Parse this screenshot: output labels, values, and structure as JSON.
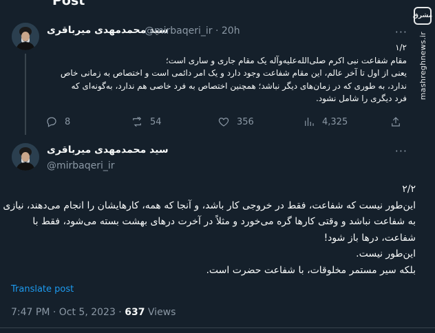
{
  "header": {
    "title": "Post"
  },
  "watermark": {
    "logo_text": "مشرق",
    "url": "mashreghnews.ir"
  },
  "tweet1": {
    "author_name": "سید محمدمهدی میرباقری",
    "meta": "@mirbaqeri_ir · 20h",
    "more": "···",
    "lines": [
      "۱/۲",
      "مقام شفاعت نبی اکرم صلی‌الله‌علیه‌وآله یک مقام جاری و ساری است؛",
      "یعنی از اول تا آخر عالم، این مقام شفاعت وجود دارد و یک امر دائمی است و اختصاص به زمانی خاص",
      "ندارد، به طوری که در زمان‌های دیگر نباشد؛ همچنین اختصاص به فرد خاصی هم ندارد، به‌گونه‌ای که",
      "فرد دیگری را شامل نشود."
    ],
    "stats": {
      "replies": "8",
      "reposts": "54",
      "likes": "356",
      "views": "4,325"
    },
    "icons": {
      "reply": "reply-icon",
      "repost": "repost-icon",
      "like": "heart-icon",
      "views": "views-icon",
      "share": "share-icon"
    }
  },
  "tweet2": {
    "author_name": "سید محمدمهدی میرباقری",
    "handle": "@mirbaqeri_ir",
    "more": "···",
    "lines": [
      "۲/۲",
      "این‌طور نیست که شفاعت، فقط در خروجی کار باشد، و آنجا که همه، کارهایشان را انجام می‌دهند، نیازی",
      "به شفاعت نباشد و وقتی کارها گره می‌خورد و مثلاً در آخرت درهای بهشت بسته می‌شود، فقط با",
      "شفاعت، درها باز شود!",
      "این‌طور نیست.",
      "بلکه سیر مستمر مخلوقات، با شفاعت حضرت است."
    ],
    "translate": "Translate post",
    "timestamp": "7:47 PM · Oct 5, 2023 · ",
    "views_count": "637",
    "views_label": " Views"
  },
  "colors": {
    "background": "#15202b",
    "text": "#f7f9f9",
    "muted": "#8b98a5",
    "link": "#1d9bf0",
    "border": "#38444d"
  }
}
